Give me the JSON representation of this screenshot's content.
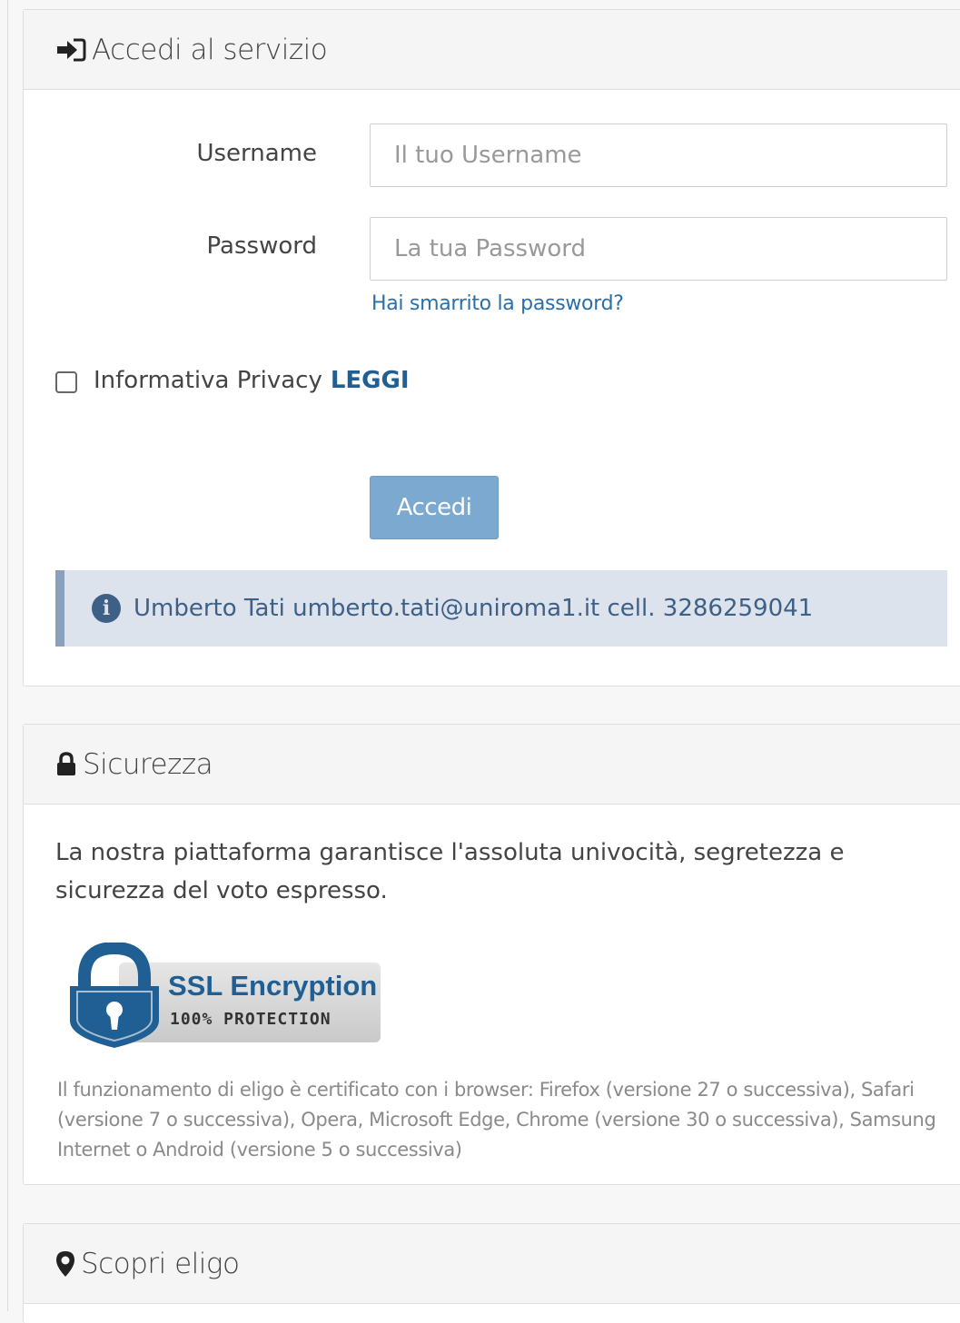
{
  "login_panel": {
    "title": "Accedi al servizio",
    "title_icon": "sign-in-icon",
    "username_label": "Username",
    "username_placeholder": "Il tuo Username",
    "password_label": "Password",
    "password_placeholder": "La tua Password",
    "forgot_password_link": "Hai smarrito la password?",
    "privacy_label": "Informativa Privacy",
    "privacy_link": "LEGGI",
    "privacy_checked": false,
    "submit_label": "Accedi",
    "contact_info": "Umberto Tati umberto.tati@uniroma1.it cell. 3286259041",
    "contact_icon": "info-circle-icon"
  },
  "security_panel": {
    "title": "Sicurezza",
    "title_icon": "lock-icon",
    "description": "La nostra piattaforma garantisce l'assoluta univocità, segretezza e sicurezza del voto espresso.",
    "badge_title": "SSL Encryption",
    "badge_subtitle": "100% PROTECTION",
    "browser_note": "Il funzionamento di eligo è certificato con i browser: Firefox (versione 27 o successiva), Safari (versione 7 o successiva), Opera, Microsoft Edge, Chrome (versione 30 o successiva), Samsung Internet o Android (versione 5 o successiva)"
  },
  "discover_panel": {
    "title": "Scopri eligo",
    "title_icon": "map-marker-icon"
  },
  "colors": {
    "link": "#2a6fa8",
    "button": "#7ca9cf",
    "alert_bg": "#dde3ec",
    "alert_text": "#3e5f86",
    "badge_blue": "#1f5f93"
  }
}
